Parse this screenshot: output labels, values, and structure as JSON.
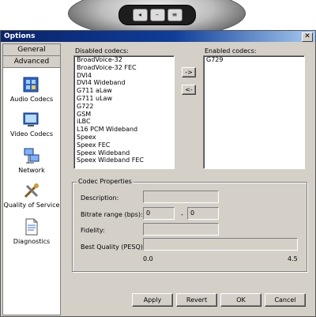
{
  "phone": {
    "buttons": [
      "◂",
      "–",
      "≡"
    ]
  },
  "window": {
    "title": "Options",
    "close_label": "✕"
  },
  "nav": {
    "tabs": [
      "General",
      "Advanced"
    ],
    "items": [
      "Audio Codecs",
      "Video Codecs",
      "Network",
      "Quality of Service",
      "Diagnostics"
    ]
  },
  "codecs": {
    "disabled_label": "Disabled codecs:",
    "enabled_label": "Enabled codecs:",
    "disabled": [
      "BroadVoice-32",
      "BroadVoice-32 FEC",
      "DVI4",
      "DVI4 Wideband",
      "G711 aLaw",
      "G711 uLaw",
      "G722",
      "GSM",
      "iLBC",
      "L16 PCM Wideband",
      "Speex",
      "Speex FEC",
      "Speex Wideband",
      "Speex Wideband FEC"
    ],
    "enabled": [
      "G729"
    ],
    "move_right_label": "->",
    "move_left_label": "<-"
  },
  "properties": {
    "group_title": "Codec Properties",
    "description_label": "Description:",
    "description_value": "",
    "bitrate_label": "Bitrate range (bps):",
    "bitrate_min": "0",
    "bitrate_sep": "-",
    "bitrate_max": "0",
    "fidelity_label": "Fidelity:",
    "fidelity_value": "",
    "quality_label": "Best Quality (PESQ):",
    "quality_value": 0,
    "quality_min": "0.0",
    "quality_max": "4.5"
  },
  "buttons": {
    "apply": "Apply",
    "revert": "Revert",
    "ok": "OK",
    "cancel": "Cancel"
  }
}
